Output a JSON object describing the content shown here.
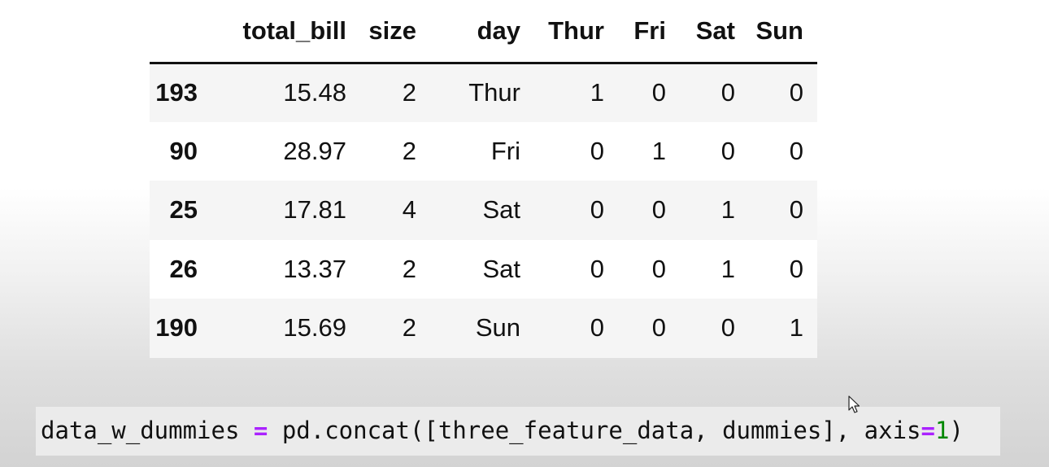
{
  "dataframe": {
    "columns": [
      "",
      "total_bill",
      "size",
      "day",
      "Thur",
      "Fri",
      "Sat",
      "Sun"
    ],
    "rows": [
      {
        "index": "193",
        "total_bill": "15.48",
        "size": "2",
        "day": "Thur",
        "Thur": "1",
        "Fri": "0",
        "Sat": "0",
        "Sun": "0"
      },
      {
        "index": "90",
        "total_bill": "28.97",
        "size": "2",
        "day": "Fri",
        "Thur": "0",
        "Fri": "1",
        "Sat": "0",
        "Sun": "0"
      },
      {
        "index": "25",
        "total_bill": "17.81",
        "size": "4",
        "day": "Sat",
        "Thur": "0",
        "Fri": "0",
        "Sat": "1",
        "Sun": "0"
      },
      {
        "index": "26",
        "total_bill": "13.37",
        "size": "2",
        "day": "Sat",
        "Thur": "0",
        "Fri": "0",
        "Sat": "1",
        "Sun": "0"
      },
      {
        "index": "190",
        "total_bill": "15.69",
        "size": "2",
        "day": "Sun",
        "Thur": "0",
        "Fri": "0",
        "Sat": "0",
        "Sun": "1"
      }
    ]
  },
  "code": {
    "var": "data_w_dummies ",
    "assign": "=",
    "call": " pd.concat([three_feature_data, dummies], axis",
    "kw_eq": "=",
    "num": "1",
    "close": ")"
  },
  "icons": {
    "cursor": "mouse-pointer-icon"
  },
  "colors": {
    "operator": "#aa22ff",
    "number": "#008800",
    "code_background": "#ebebeb",
    "striped_row": "#f5f5f5"
  }
}
